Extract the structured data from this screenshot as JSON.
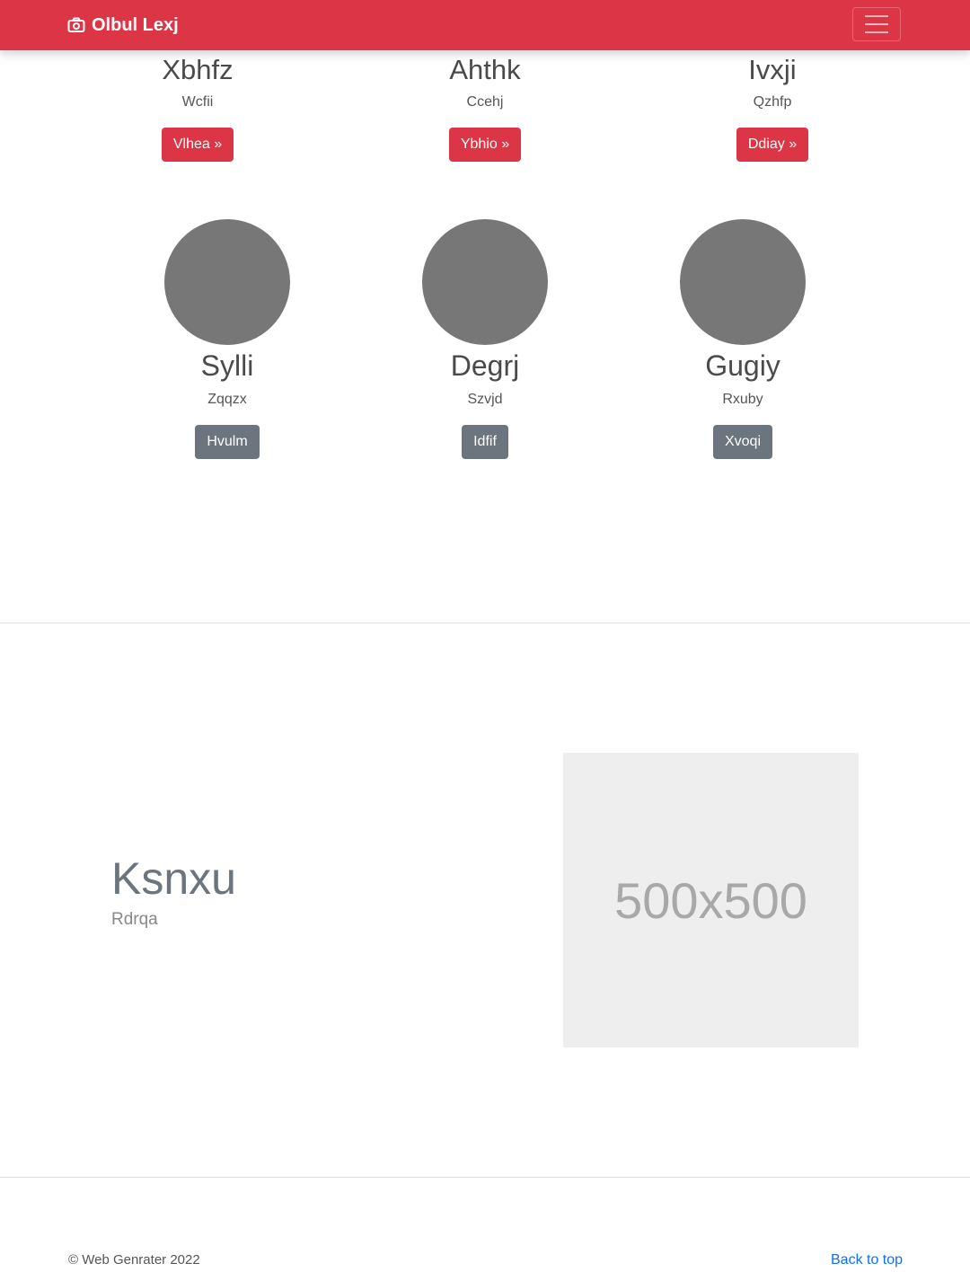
{
  "navbar": {
    "brand": "Olbul Lexj",
    "brand_icon": "camera-icon",
    "bg_color": "#dc3545"
  },
  "top_columns": [
    {
      "title": "Xbhfz",
      "subtitle": "Wcfii",
      "button": "Vlhea »"
    },
    {
      "title": "Ahthk",
      "subtitle": "Ccehj",
      "button": "Ybhio »"
    },
    {
      "title": "Ivxji",
      "subtitle": "Qzhfp",
      "button": "Ddiay »"
    }
  ],
  "mid_columns": [
    {
      "title": "Sylli",
      "subtitle": "Zqqzx",
      "button": "Hvulm"
    },
    {
      "title": "Degrj",
      "subtitle": "Szvjd",
      "button": "Idfif"
    },
    {
      "title": "Gugiy",
      "subtitle": "Rxuby",
      "button": "Xvoqi"
    }
  ],
  "feature": {
    "title": "Ksnxu",
    "subtitle": "Rdrqa",
    "image_text": "500x500"
  },
  "footer": {
    "copyright": "© Web Genrater 2022",
    "back_to_top": "Back to top"
  }
}
